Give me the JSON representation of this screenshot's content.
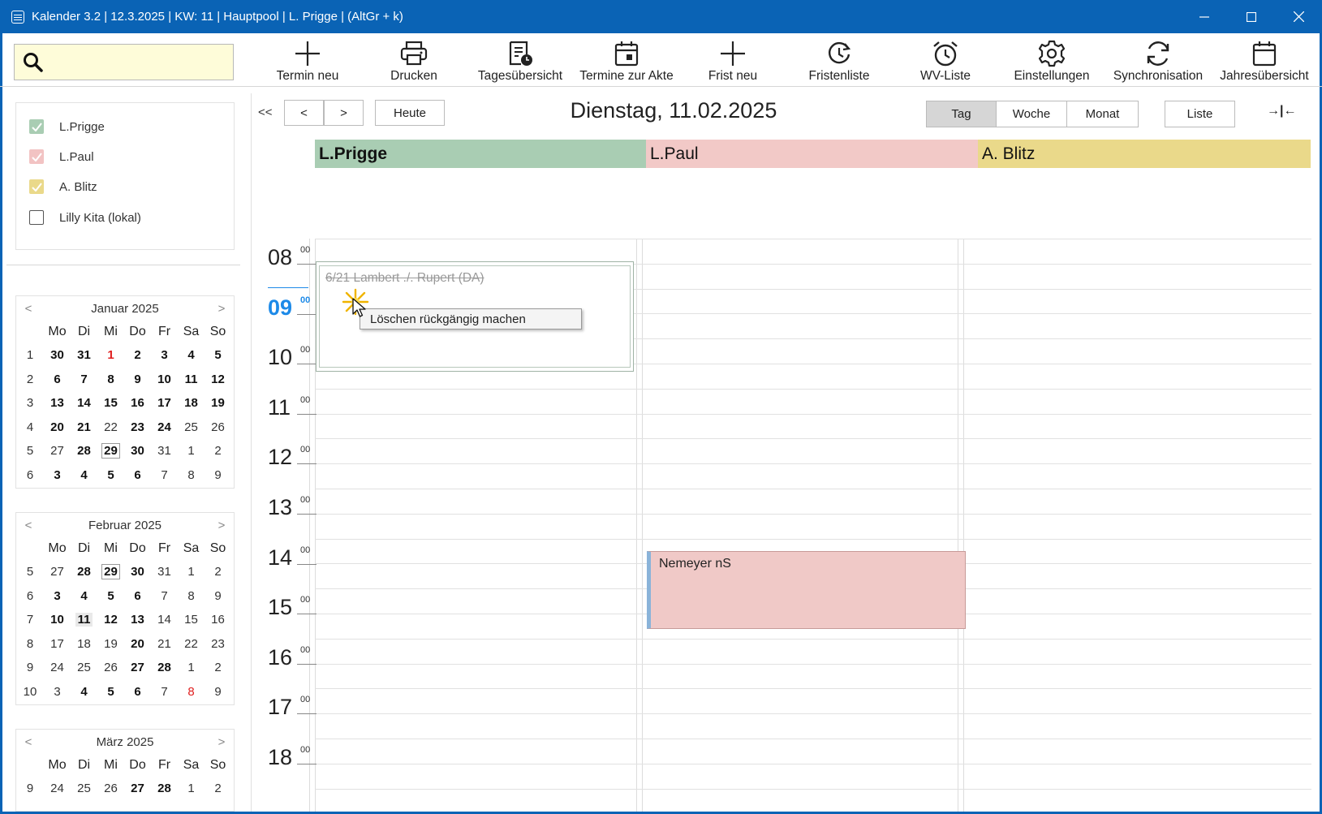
{
  "window": {
    "title": "Kalender 3.2 | 12.3.2025 | KW: 11 | Hauptpool | L. Prigge | (AltGr + k)",
    "minimize": "—",
    "maximize": "☐",
    "close": "✕"
  },
  "search": {
    "value": "",
    "placeholder": ""
  },
  "toolbar": {
    "items": [
      {
        "label": "Termin neu",
        "icon": "plus-icon"
      },
      {
        "label": "Drucken",
        "icon": "printer-icon"
      },
      {
        "label": "Tagesübersicht",
        "icon": "day-overview-icon"
      },
      {
        "label": "Termine zur Akte",
        "icon": "calendar-file-icon"
      },
      {
        "label": "Frist neu",
        "icon": "plus-icon"
      },
      {
        "label": "Fristenliste",
        "icon": "deadline-list-icon"
      },
      {
        "label": "WV-Liste",
        "icon": "alarm-clock-icon"
      },
      {
        "label": "Einstellungen",
        "icon": "gear-icon"
      },
      {
        "label": "Synchronisation",
        "icon": "sync-icon"
      },
      {
        "label": "Jahresübersicht",
        "icon": "calendar-icon"
      }
    ]
  },
  "calendars": [
    {
      "label": "L.Prigge",
      "checked": true,
      "color": "#a9cdb3"
    },
    {
      "label": "L.Paul",
      "checked": true,
      "color": "#f2c3c3"
    },
    {
      "label": "A. Blitz",
      "checked": true,
      "color": "#ead98a"
    },
    {
      "label": "Lilly Kita (lokal)",
      "checked": false,
      "color": "#ffffff"
    }
  ],
  "dow": [
    "Mo",
    "Di",
    "Mi",
    "Do",
    "Fr",
    "Sa",
    "So"
  ],
  "mini_calendars": [
    {
      "title": "Januar 2025",
      "weeks": [
        {
          "w": "1",
          "days": [
            [
              "30",
              "b"
            ],
            [
              "31",
              "b"
            ],
            [
              "1",
              "b red"
            ],
            [
              "2",
              "b"
            ],
            [
              "3",
              "b"
            ],
            [
              "4",
              "b"
            ],
            [
              "5",
              "b"
            ]
          ]
        },
        {
          "w": "2",
          "days": [
            [
              "6",
              "b"
            ],
            [
              "7",
              "b"
            ],
            [
              "8",
              "b"
            ],
            [
              "9",
              "b"
            ],
            [
              "10",
              "b"
            ],
            [
              "11",
              "b"
            ],
            [
              "12",
              "b"
            ]
          ]
        },
        {
          "w": "3",
          "days": [
            [
              "13",
              "b"
            ],
            [
              "14",
              "b"
            ],
            [
              "15",
              "b"
            ],
            [
              "16",
              "b"
            ],
            [
              "17",
              "b"
            ],
            [
              "18",
              "b"
            ],
            [
              "19",
              "b"
            ]
          ]
        },
        {
          "w": "4",
          "days": [
            [
              "20",
              "b"
            ],
            [
              "21",
              "b"
            ],
            [
              "22",
              ""
            ],
            [
              "23",
              "b"
            ],
            [
              "24",
              "b"
            ],
            [
              "25",
              ""
            ],
            [
              "26",
              ""
            ]
          ]
        },
        {
          "w": "5",
          "days": [
            [
              "27",
              ""
            ],
            [
              "28",
              "b"
            ],
            [
              "29",
              "b boxed"
            ],
            [
              "30",
              "b"
            ],
            [
              "31",
              ""
            ],
            [
              "1",
              ""
            ],
            [
              "2",
              ""
            ]
          ]
        },
        {
          "w": "6",
          "days": [
            [
              "3",
              "b"
            ],
            [
              "4",
              "b"
            ],
            [
              "5",
              "b"
            ],
            [
              "6",
              "b"
            ],
            [
              "7",
              ""
            ],
            [
              "8",
              ""
            ],
            [
              "9",
              ""
            ]
          ]
        }
      ]
    },
    {
      "title": "Februar 2025",
      "weeks": [
        {
          "w": "5",
          "days": [
            [
              "27",
              ""
            ],
            [
              "28",
              "b"
            ],
            [
              "29",
              "b boxed"
            ],
            [
              "30",
              "b"
            ],
            [
              "31",
              ""
            ],
            [
              "1",
              ""
            ],
            [
              "2",
              ""
            ]
          ]
        },
        {
          "w": "6",
          "days": [
            [
              "3",
              "b"
            ],
            [
              "4",
              "b"
            ],
            [
              "5",
              "b"
            ],
            [
              "6",
              "b"
            ],
            [
              "7",
              ""
            ],
            [
              "8",
              ""
            ],
            [
              "9",
              ""
            ]
          ]
        },
        {
          "w": "7",
          "days": [
            [
              "10",
              "b"
            ],
            [
              "11",
              "b sel"
            ],
            [
              "12",
              "b"
            ],
            [
              "13",
              "b"
            ],
            [
              "14",
              ""
            ],
            [
              "15",
              ""
            ],
            [
              "16",
              ""
            ]
          ]
        },
        {
          "w": "8",
          "days": [
            [
              "17",
              ""
            ],
            [
              "18",
              ""
            ],
            [
              "19",
              ""
            ],
            [
              "20",
              "b"
            ],
            [
              "21",
              ""
            ],
            [
              "22",
              ""
            ],
            [
              "23",
              ""
            ]
          ]
        },
        {
          "w": "9",
          "days": [
            [
              "24",
              ""
            ],
            [
              "25",
              ""
            ],
            [
              "26",
              ""
            ],
            [
              "27",
              "b"
            ],
            [
              "28",
              "b"
            ],
            [
              "1",
              ""
            ],
            [
              "2",
              ""
            ]
          ]
        },
        {
          "w": "10",
          "days": [
            [
              "3",
              ""
            ],
            [
              "4",
              "b"
            ],
            [
              "5",
              "b"
            ],
            [
              "6",
              "b"
            ],
            [
              "7",
              ""
            ],
            [
              "8",
              "red"
            ],
            [
              "9",
              ""
            ]
          ]
        }
      ]
    },
    {
      "title": "März 2025",
      "weeks": [
        {
          "w": "9",
          "days": [
            [
              "24",
              ""
            ],
            [
              "25",
              ""
            ],
            [
              "26",
              ""
            ],
            [
              "27",
              "b"
            ],
            [
              "28",
              "b"
            ],
            [
              "1",
              ""
            ],
            [
              "2",
              ""
            ]
          ]
        }
      ]
    }
  ],
  "nav": {
    "skip_back": "<<",
    "prev": "<",
    "next": ">",
    "today": "Heute",
    "date_title": "Dienstag, 11.02.2025",
    "views": [
      {
        "label": "Tag",
        "active": true
      },
      {
        "label": "Woche",
        "active": false
      },
      {
        "label": "Monat",
        "active": false
      }
    ],
    "list": "Liste",
    "collapse": "→|←"
  },
  "resources": [
    {
      "label": "L.Prigge",
      "color": "#a9cdb3",
      "bold": true
    },
    {
      "label": "L.Paul",
      "color": "#f2c9c7",
      "bold": false
    },
    {
      "label": "A. Blitz",
      "color": "#ead98a",
      "bold": false
    }
  ],
  "hours": [
    {
      "h": "08",
      "m": "00",
      "current": false
    },
    {
      "h": "09",
      "m": "00",
      "current": true
    },
    {
      "h": "10",
      "m": "00",
      "current": false
    },
    {
      "h": "11",
      "m": "00",
      "current": false
    },
    {
      "h": "12",
      "m": "00",
      "current": false
    },
    {
      "h": "13",
      "m": "00",
      "current": false
    },
    {
      "h": "14",
      "m": "00",
      "current": false
    },
    {
      "h": "15",
      "m": "00",
      "current": false
    },
    {
      "h": "16",
      "m": "00",
      "current": false
    },
    {
      "h": "17",
      "m": "00",
      "current": false
    },
    {
      "h": "18",
      "m": "00",
      "current": false
    }
  ],
  "events": {
    "deleted": {
      "title": "6/21 Lambert ./. Rupert (DA)"
    },
    "nemeyer": {
      "title": "Nemeyer nS"
    }
  },
  "context_menu": {
    "undo_delete": "Löschen rückgängig machen"
  }
}
